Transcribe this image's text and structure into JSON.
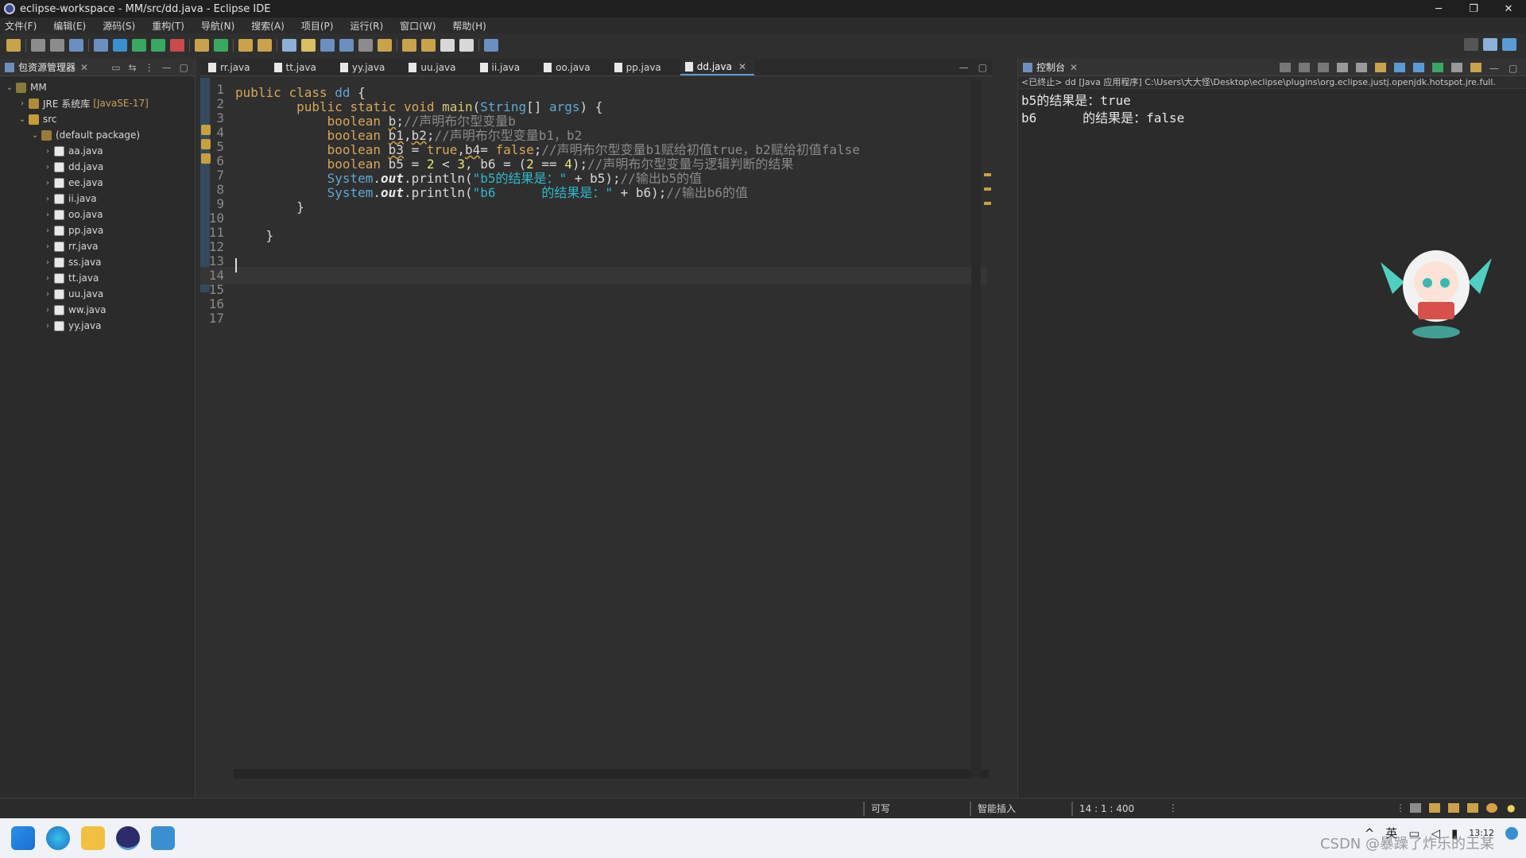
{
  "window": {
    "title": "eclipse-workspace - MM/src/dd.java - Eclipse IDE",
    "minimize": "─",
    "maximize": "❐",
    "close": "✕"
  },
  "menu": [
    "文件(F)",
    "编辑(E)",
    "源码(S)",
    "重构(T)",
    "导航(N)",
    "搜索(A)",
    "项目(P)",
    "运行(R)",
    "窗口(W)",
    "帮助(H)"
  ],
  "package_explorer": {
    "title": "包资源管理器",
    "tree": [
      {
        "label": "MM",
        "level": 0,
        "chev": "⌄",
        "icon": "project-icon"
      },
      {
        "label": "JRE 系统库",
        "extra": "[JavaSE-17]",
        "level": 1,
        "chev": "›",
        "icon": "library-icon"
      },
      {
        "label": "src",
        "level": 1,
        "chev": "⌄",
        "icon": "source-folder-icon"
      },
      {
        "label": "(default package)",
        "level": 2,
        "chev": "⌄",
        "icon": "package-icon"
      },
      {
        "label": "aa.java",
        "level": 3,
        "chev": "›",
        "icon": "java-file-icon"
      },
      {
        "label": "dd.java",
        "level": 3,
        "chev": "›",
        "icon": "java-file-icon"
      },
      {
        "label": "ee.java",
        "level": 3,
        "chev": "›",
        "icon": "java-file-icon"
      },
      {
        "label": "ii.java",
        "level": 3,
        "chev": "›",
        "icon": "java-file-icon"
      },
      {
        "label": "oo.java",
        "level": 3,
        "chev": "›",
        "icon": "java-file-icon"
      },
      {
        "label": "pp.java",
        "level": 3,
        "chev": "›",
        "icon": "java-file-icon"
      },
      {
        "label": "rr.java",
        "level": 3,
        "chev": "›",
        "icon": "java-file-icon"
      },
      {
        "label": "ss.java",
        "level": 3,
        "chev": "›",
        "icon": "java-file-icon"
      },
      {
        "label": "tt.java",
        "level": 3,
        "chev": "›",
        "icon": "java-file-icon"
      },
      {
        "label": "uu.java",
        "level": 3,
        "chev": "›",
        "icon": "java-file-icon"
      },
      {
        "label": "ww.java",
        "level": 3,
        "chev": "›",
        "icon": "java-file-icon"
      },
      {
        "label": "yy.java",
        "level": 3,
        "chev": "›",
        "icon": "java-file-icon"
      }
    ]
  },
  "editor": {
    "tabs": [
      "rr.java",
      "tt.java",
      "yy.java",
      "uu.java",
      "ii.java",
      "oo.java",
      "pp.java",
      "dd.java"
    ],
    "active_tab": "dd.java",
    "line_numbers": [
      "1",
      "2",
      "3",
      "4",
      "5",
      "6",
      "7",
      "8",
      "9",
      "10",
      "11",
      "12",
      "13",
      "14",
      "15",
      "16",
      "17"
    ],
    "current_line": 14
  },
  "console": {
    "title": "控制台",
    "path": "<已终止> dd [Java 应用程序] C:\\Users\\大大怪\\Desktop\\eclipse\\plugins\\org.eclipse.justj.openjdk.hotspot.jre.full.",
    "output": [
      "b5的结果是：true",
      "b6      的结果是：false"
    ]
  },
  "status": {
    "writable": "可写",
    "insert_mode": "智能插入",
    "position": "14 : 1 : 400"
  },
  "taskbar": {
    "tray_ime": "英",
    "time": "13:12",
    "watermark": "CSDN @暴躁了炸乐的王某"
  },
  "colors": {
    "keyword": "#d8a657",
    "class": "#5fa8d3",
    "string": "#2fb8c8",
    "comment": "#8a8a8a",
    "accent": "#5a9bd5"
  }
}
